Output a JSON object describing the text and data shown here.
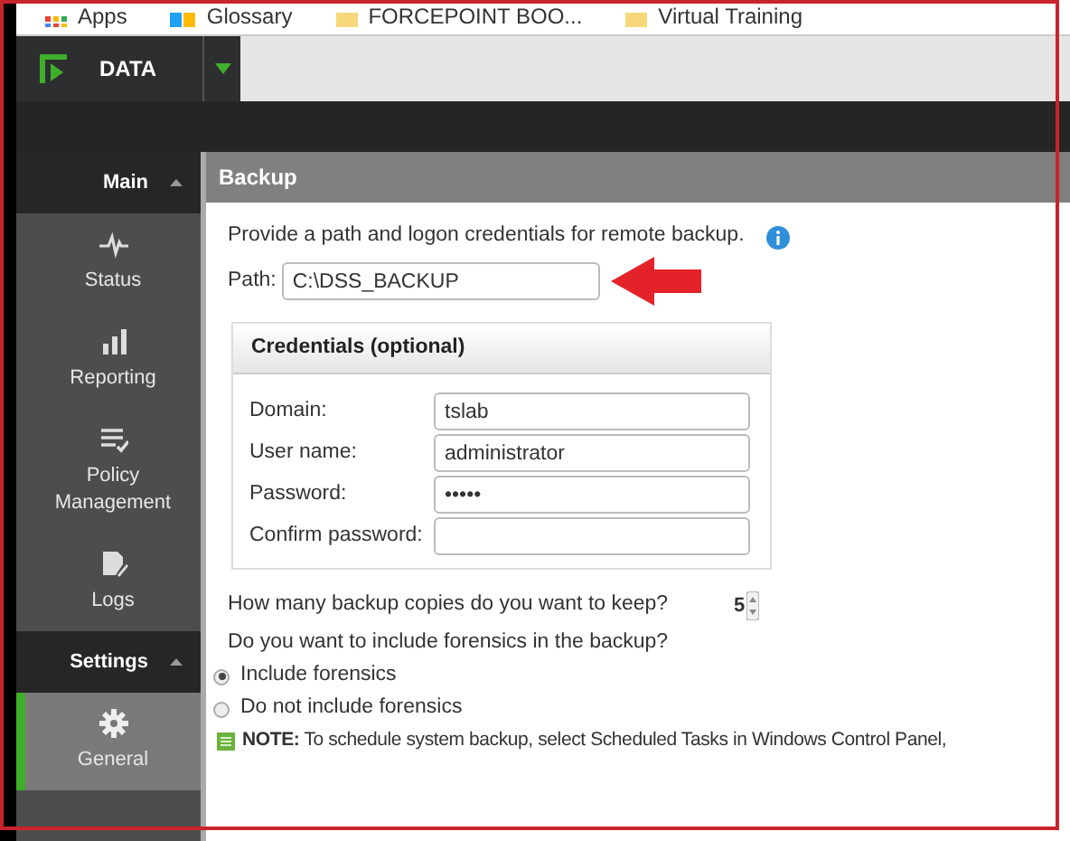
{
  "bookmarks": [
    {
      "label": "Apps",
      "kind": "apps"
    },
    {
      "label": "Glossary",
      "kind": "app"
    },
    {
      "label": "FORCEPOINT BOO...",
      "kind": "folder"
    },
    {
      "label": "Virtual Training",
      "kind": "folder"
    }
  ],
  "app": {
    "product": "DATA"
  },
  "sidebar": {
    "sections": [
      {
        "title": "Main",
        "expanded": true,
        "items": [
          {
            "label": "Status",
            "selected": false
          },
          {
            "label": "Reporting",
            "selected": false
          },
          {
            "label": "Policy Management",
            "selected": false
          },
          {
            "label": "Logs",
            "selected": false
          }
        ]
      },
      {
        "title": "Settings",
        "expanded": true,
        "items": [
          {
            "label": "General",
            "selected": true
          }
        ]
      }
    ]
  },
  "panel": {
    "title": "Backup",
    "intro": "Provide a path and logon credentials for remote backup.",
    "path": {
      "label": "Path:",
      "value": "C:\\DSS_BACKUP"
    },
    "credentials": {
      "title": "Credentials (optional)",
      "fields": [
        {
          "label": "Domain:",
          "value": "tslab"
        },
        {
          "label": "User name:",
          "value": "administrator"
        },
        {
          "label": "Password:",
          "value": "•••••"
        },
        {
          "label": "Confirm password:"
        }
      ]
    },
    "copies": {
      "label": "How many backup copies do you want to keep?",
      "value": "5"
    },
    "forensics": {
      "question": "Do you want to include forensics in the backup?",
      "options": [
        {
          "label": "Include forensics",
          "selected": true
        },
        {
          "label": "Do not include forensics",
          "selected": false
        }
      ]
    },
    "note": "**NOTE:** To schedule system backup, select Scheduled Tasks in Windows Control Panel,"
  }
}
